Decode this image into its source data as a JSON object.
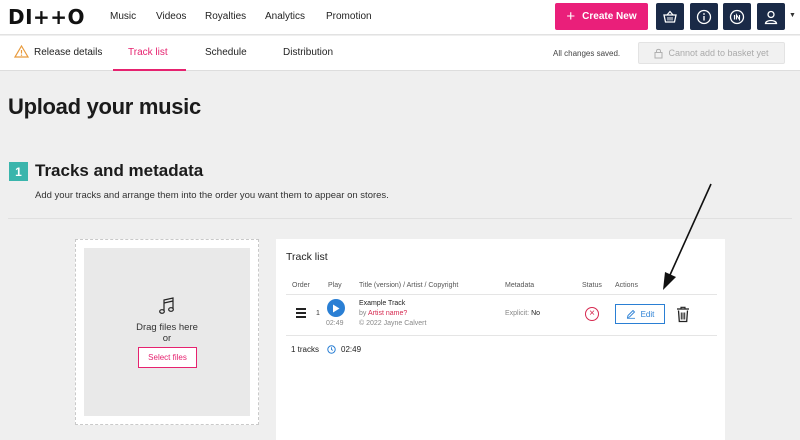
{
  "brand": {
    "logo": "DI++O",
    "accent": "#ea1f7a",
    "navy": "#1a2a47",
    "teal": "#3ab5ac",
    "blue": "#2a7fd4"
  },
  "nav": {
    "links": [
      "Music",
      "Videos",
      "Royalties",
      "Analytics",
      "Promotion"
    ],
    "create_label": "Create New",
    "icons": [
      "basket-icon",
      "info-icon",
      "in-icon",
      "user-icon"
    ]
  },
  "subnav": {
    "tabs": [
      "Release details",
      "Track list",
      "Schedule",
      "Distribution"
    ],
    "active_tab": "Track list",
    "saved_text": "All changes saved.",
    "basket_label": "Cannot add to basket yet"
  },
  "page": {
    "title": "Upload your music",
    "step_number": "1",
    "section_title": "Tracks and metadata",
    "section_desc": "Add your tracks and arrange them into the order you want them to appear on stores."
  },
  "upload": {
    "drag_text": "Drag files here",
    "or_text": "or",
    "select_label": "Select files"
  },
  "tracklist": {
    "title": "Track list",
    "columns": [
      "Order",
      "Play",
      "Title (version) / Artist / Copyright",
      "Metadata",
      "Status",
      "Actions"
    ],
    "rows": [
      {
        "order": "1",
        "duration": "02:49",
        "title": "Example Track",
        "artist_prefix": "by",
        "artist": "Artist name?",
        "copyright": "© 2022 Jayne Calvert",
        "metadata_label": "Explicit:",
        "metadata_value": "No",
        "status": "error",
        "edit_label": "Edit"
      }
    ],
    "summary_count": "1 tracks",
    "summary_duration": "02:49"
  }
}
